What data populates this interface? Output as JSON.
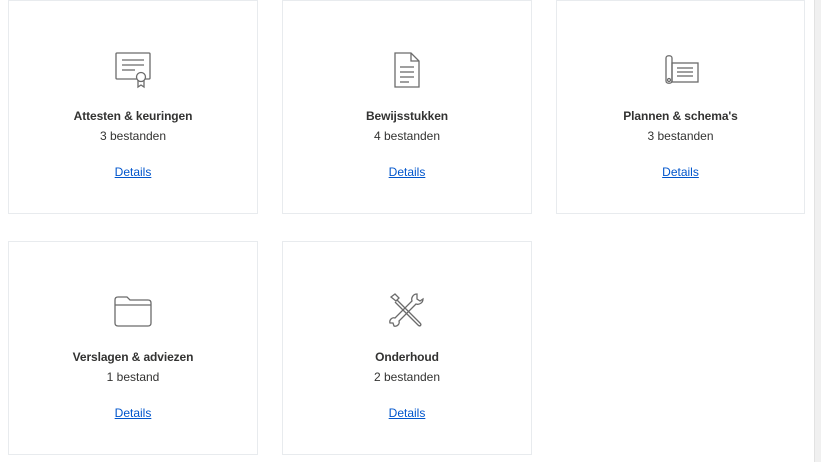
{
  "cards": [
    {
      "title": "Attesten & keuringen",
      "count": "3 bestanden",
      "link": "Details",
      "icon": "certificate-icon"
    },
    {
      "title": "Bewijsstukken",
      "count": "4 bestanden",
      "link": "Details",
      "icon": "document-icon"
    },
    {
      "title": "Plannen & schema's",
      "count": "3 bestanden",
      "link": "Details",
      "icon": "blueprint-scroll-icon"
    },
    {
      "title": "Verslagen & adviezen",
      "count": "1 bestand",
      "link": "Details",
      "icon": "folder-icon"
    },
    {
      "title": "Onderhoud",
      "count": "2 bestanden",
      "link": "Details",
      "icon": "tools-icon"
    }
  ],
  "colors": {
    "link": "#0055cc",
    "text": "#333332",
    "icon": "#6b6b6b",
    "border": "#e8ebee"
  }
}
